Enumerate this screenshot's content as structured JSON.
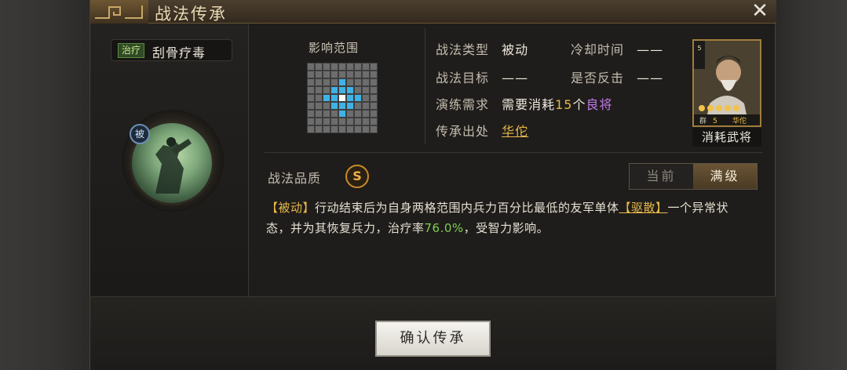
{
  "window": {
    "title": "战法传承"
  },
  "skill": {
    "tag": "治疗",
    "name": "刮骨疗毒",
    "passive_badge": "被"
  },
  "range": {
    "label": "影响范围"
  },
  "info": {
    "type_label": "战法类型",
    "type_value": "被动",
    "cooldown_label": "冷却时间",
    "cooldown_value": "——",
    "target_label": "战法目标",
    "target_value": "——",
    "counter_label": "是否反击",
    "counter_value": "——",
    "train_label": "演练需求",
    "train_prefix": "需要消耗",
    "train_count": "15",
    "train_unit": "个",
    "train_item": "良将",
    "origin_label": "传承出处",
    "origin_value": "华佗"
  },
  "portrait": {
    "cost": "5",
    "faction": "群",
    "level": "5",
    "name": "华佗",
    "consume_label": "消耗武将"
  },
  "quality": {
    "label": "战法品质",
    "grade": "S"
  },
  "level_toggle": {
    "current": "当前",
    "max": "满级",
    "selected": "max"
  },
  "description": {
    "p1": "【被动】",
    "p2": "行动结束后为自身两格范围内兵力百分比最低的友军单体",
    "p3": "【驱散】",
    "p4": "一个异常状态，并为其恢复兵力，治疗率",
    "p5": "76.0%",
    "p6": "，受智力影响。"
  },
  "buttons": {
    "confirm": "确认传承",
    "close": "✕"
  },
  "colors": {
    "accent_gold": "#e8b94a",
    "heal_green": "#7fcc52",
    "range_blue": "#3fb2e6",
    "item_purple": "#c07ae8"
  }
}
